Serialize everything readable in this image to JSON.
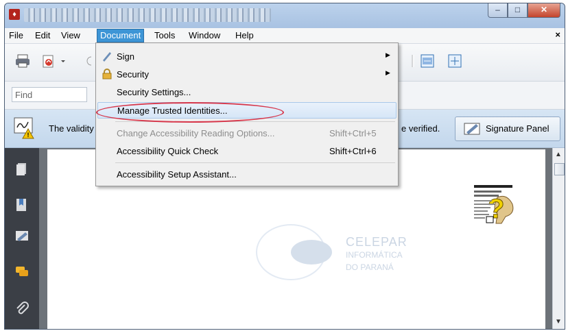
{
  "menubar": {
    "items": [
      "File",
      "Edit",
      "View",
      "Document",
      "Tools",
      "Window",
      "Help"
    ],
    "close_label": "×"
  },
  "find": {
    "placeholder": "Find"
  },
  "sigbar": {
    "validity_text": "The validity",
    "verified_text": "e verified.",
    "signature_panel_label": "Signature Panel"
  },
  "dropdown": {
    "sign_label": "Sign",
    "security_label": "Security",
    "security_settings_label": "Security Settings...",
    "manage_trusted_label": "Manage Trusted Identities...",
    "change_access_label": "Change Accessibility Reading Options...",
    "change_access_shortcut": "Shift+Ctrl+5",
    "quick_check_label": "Accessibility Quick Check",
    "quick_check_shortcut": "Shift+Ctrl+6",
    "setup_assistant_label": "Accessibility Setup Assistant..."
  },
  "watermark": {
    "line1": "CELEPAR",
    "line2": "INFORMÁTICA",
    "line3": "DO PARANÁ"
  },
  "colors": {
    "menu_active": "#3d95d6",
    "highlight_ring": "#d7364a",
    "left_rail": "#3b3f46"
  }
}
